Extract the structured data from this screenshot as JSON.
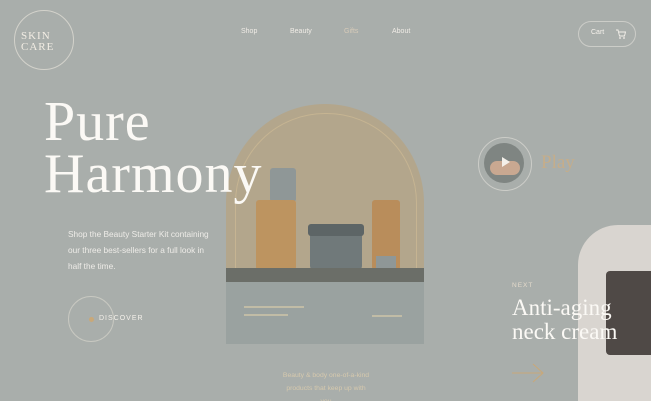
{
  "logo": {
    "text_line1": "SKIN",
    "text_line2": "CARE"
  },
  "nav": {
    "items": [
      "Shop",
      "Beauty",
      "Gifts",
      "About"
    ],
    "active": "Gifts"
  },
  "cart": {
    "label": "Cart",
    "icon": "cart-icon"
  },
  "hero": {
    "title_line1": "Pure",
    "title_line2": "Harmony",
    "description": "Shop the Beauty Starter Kit containing our three best-sellers for a full look in half the time.",
    "discover_label": "DISCOVER"
  },
  "product": {
    "caption": "Beauty & body one-of-a-kind products that keep up with you"
  },
  "play": {
    "label": "Play",
    "icon": "play-icon"
  },
  "next": {
    "label": "NEXT",
    "title_line1": "Anti-aging",
    "title_line2": "neck cream",
    "icon": "arrow-right-icon"
  },
  "colors": {
    "background": "#a9aeab",
    "accent": "#c5ad8a",
    "text": "#fbf9f5"
  }
}
